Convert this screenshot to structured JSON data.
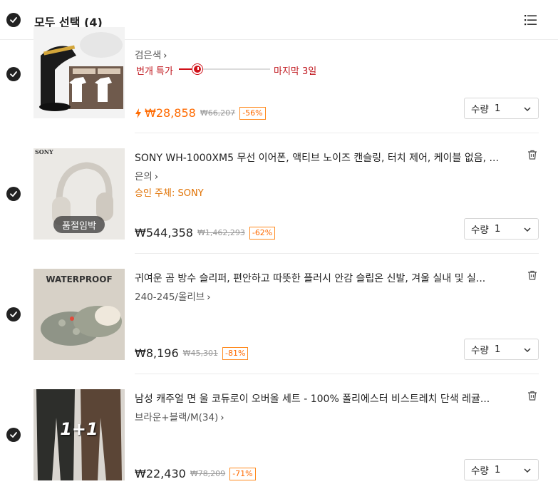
{
  "header": {
    "select_all": "모두 선택 (4)"
  },
  "items": [
    {
      "name": "",
      "option": "검은색",
      "flash": {
        "label": "번개 특가",
        "ends": "마지막 3일",
        "progress": 0.2
      },
      "price": "₩28,858",
      "original_price": "₩66,207",
      "discount": "-56%",
      "qty_label": "수량",
      "qty": "1"
    },
    {
      "name": "SONY WH-1000XM5 무선 이어폰, 액티브 노이즈 캔슬링, 터치 제어, 케이블 없음, ...",
      "option": "은의",
      "seller": "승인 주체: SONY",
      "soldout_badge": "품절임박",
      "brand_text": "SONY",
      "price": "₩544,358",
      "original_price": "₩1,462,293",
      "discount": "-62%",
      "qty_label": "수량",
      "qty": "1"
    },
    {
      "name": "귀여운 곰 방수 슬리퍼, 편안하고 따뜻한 플러시 안감 슬립온 신발, 겨울 실내 및 실...",
      "option": "240-245/올리브",
      "brand_text": "WATERPROOF",
      "price": "₩8,196",
      "original_price": "₩45,301",
      "discount": "-81%",
      "qty_label": "수량",
      "qty": "1"
    },
    {
      "name": "남성 캐주얼 면 울 코듀로이 오버올 세트 - 100% 폴리에스터 비스트레치 단색 레귤...",
      "option": "브라운+블랙/M(34)",
      "brand_text": "1+1",
      "price": "₩22,430",
      "original_price": "₩78,209",
      "discount": "-71%",
      "qty_label": "수량",
      "qty": "1"
    }
  ],
  "colors": {
    "accent_orange": "#ff6a00",
    "flash_red": "#d0121a",
    "seller_orange": "#e07000"
  }
}
